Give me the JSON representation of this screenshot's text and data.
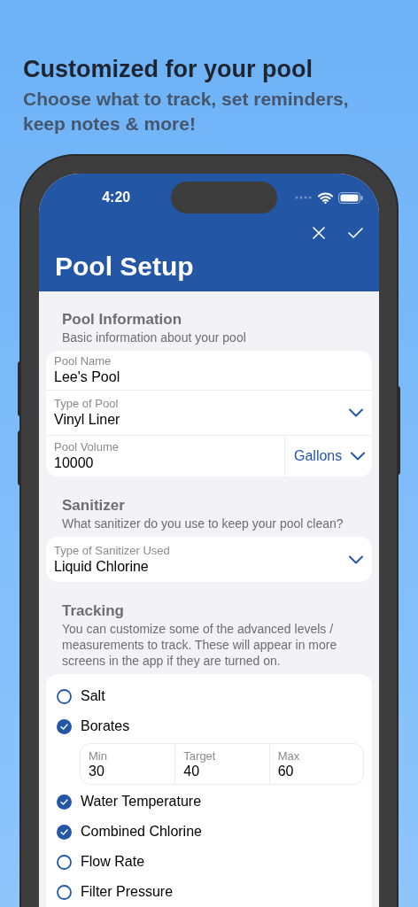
{
  "headline": "Customized for your pool",
  "subheadline": "Choose what to track, set reminders, keep notes & more!",
  "status_bar": {
    "time": "4:20"
  },
  "screen_title": "Pool Setup",
  "sections": [
    {
      "title": "Pool Information",
      "subtitle": "Basic information about your pool",
      "fields": [
        {
          "kind": "text",
          "label": "Pool Name",
          "value": "Lee's Pool"
        },
        {
          "kind": "picker",
          "label": "Type of Pool",
          "value": "Vinyl Liner"
        },
        {
          "kind": "unit",
          "label": "Pool Volume",
          "value": "10000",
          "unit": "Gallons"
        }
      ]
    },
    {
      "title": "Sanitizer",
      "subtitle": "What sanitizer do you use to keep your pool clean?",
      "fields": [
        {
          "kind": "picker",
          "label": "Type of Sanitizer Used",
          "value": "Liquid Chlorine"
        }
      ]
    }
  ],
  "tracking": {
    "title": "Tracking",
    "subtitle": "You can customize some of the advanced levels / measurements to track.  These will appear in more screens in the app if they are turned on.",
    "items": [
      {
        "label": "Salt",
        "checked": false
      },
      {
        "label": "Borates",
        "checked": true,
        "range": [
          {
            "label": "Min",
            "value": "30"
          },
          {
            "label": "Target",
            "value": "40"
          },
          {
            "label": "Max",
            "value": "60"
          }
        ]
      },
      {
        "label": "Water Temperature",
        "checked": true
      },
      {
        "label": "Combined Chlorine",
        "checked": true
      },
      {
        "label": "Flow Rate",
        "checked": false
      },
      {
        "label": "Filter Pressure",
        "checked": false
      }
    ]
  }
}
